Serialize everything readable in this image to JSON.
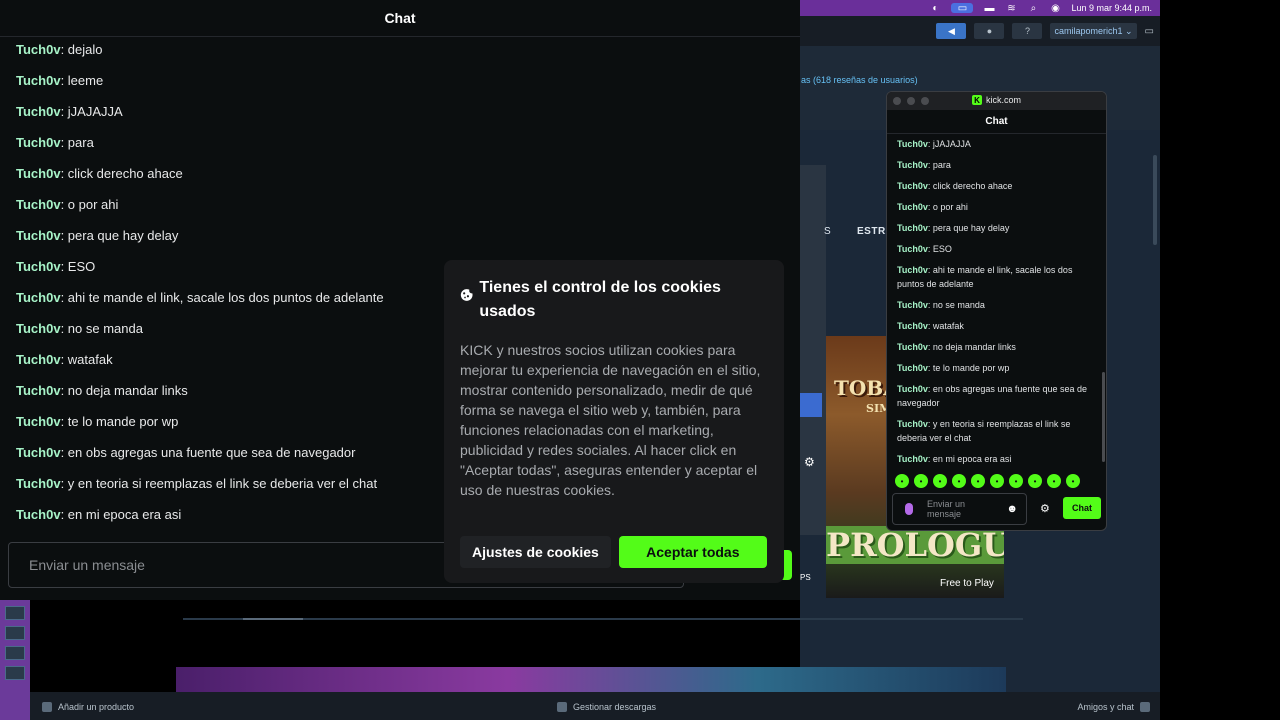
{
  "menubar": {
    "datetime": "Lun 9 mar 9:44 p.m."
  },
  "steam": {
    "account": "camilapomerich1",
    "reviews": "as (618 reseñas de usuarios)",
    "nav_letter": "S",
    "nav_item": "ESTRA",
    "game_title_top": "TOBAC",
    "game_title_sim": "SIM",
    "game_title_bottom": "PROLOGUE",
    "free_to_play": "Free to Play",
    "ps_label": "PS",
    "bottom": {
      "add_product": "Añadir un producto",
      "downloads": "Gestionar descargas",
      "friends": "Amigos y chat"
    }
  },
  "main_chat": {
    "title": "Chat",
    "input_placeholder": "Enviar un mensaje",
    "messages": [
      {
        "user": "Tuch0v",
        "text": "dejalo"
      },
      {
        "user": "Tuch0v",
        "text": "leeme"
      },
      {
        "user": "Tuch0v",
        "text": "jJAJAJJA"
      },
      {
        "user": "Tuch0v",
        "text": "para"
      },
      {
        "user": "Tuch0v",
        "text": "click derecho ahace"
      },
      {
        "user": "Tuch0v",
        "text": "o por ahi"
      },
      {
        "user": "Tuch0v",
        "text": "pera que hay delay"
      },
      {
        "user": "Tuch0v",
        "text": "ESO"
      },
      {
        "user": "Tuch0v",
        "text": "ahi te mande el link, sacale los dos puntos de adelante"
      },
      {
        "user": "Tuch0v",
        "text": "no se manda"
      },
      {
        "user": "Tuch0v",
        "text": "watafak"
      },
      {
        "user": "Tuch0v",
        "text": "no deja mandar links"
      },
      {
        "user": "Tuch0v",
        "text": "te lo mande por wp"
      },
      {
        "user": "Tuch0v",
        "text": "en obs agregas una fuente que sea de navegador"
      },
      {
        "user": "Tuch0v",
        "text": "y en teoria si reemplazas el link se deberia ver el chat"
      },
      {
        "user": "Tuch0v",
        "text": "en mi epoca era asi"
      }
    ]
  },
  "cookie_dialog": {
    "title": "Tienes el control de los cookies usados",
    "body": "KICK y nuestros socios utilizan cookies para mejorar tu experiencia de navegación en el sitio, mostrar contenido personalizado, medir de qué forma se navega el sitio web y, también, para funciones relacionadas con el marketing, publicidad y redes sociales. Al hacer click en \"Aceptar todas\", aseguras entender y aceptar el uso de nuestras cookies.",
    "settings_label": "Ajustes de cookies",
    "accept_label": "Aceptar todas"
  },
  "kick_window": {
    "url": "kick.com",
    "title": "Chat",
    "input_placeholder": "Enviar un mensaje",
    "send_label": "Chat",
    "messages": [
      {
        "user": "Tuch0v",
        "text": "jJAJAJJA"
      },
      {
        "user": "Tuch0v",
        "text": "para"
      },
      {
        "user": "Tuch0v",
        "text": "click derecho ahace"
      },
      {
        "user": "Tuch0v",
        "text": "o por ahi"
      },
      {
        "user": "Tuch0v",
        "text": "pera que hay delay"
      },
      {
        "user": "Tuch0v",
        "text": "ESO"
      },
      {
        "user": "Tuch0v",
        "text": "ahi te mande el link, sacale los dos puntos de adelante"
      },
      {
        "user": "Tuch0v",
        "text": "no se manda"
      },
      {
        "user": "Tuch0v",
        "text": "watafak"
      },
      {
        "user": "Tuch0v",
        "text": "no deja mandar links"
      },
      {
        "user": "Tuch0v",
        "text": "te lo mande por wp"
      },
      {
        "user": "Tuch0v",
        "text": "en obs agregas una fuente que sea de navegador"
      },
      {
        "user": "Tuch0v",
        "text": "y en teoria si reemplazas el link se deberia ver el chat"
      },
      {
        "user": "Tuch0v",
        "text": "en mi epoca era asi"
      }
    ]
  },
  "colors": {
    "kick_green": "#53fc18",
    "username": "#a7f3c8",
    "steam_bg": "#1b2838",
    "menubar": "#6a2f9a"
  }
}
